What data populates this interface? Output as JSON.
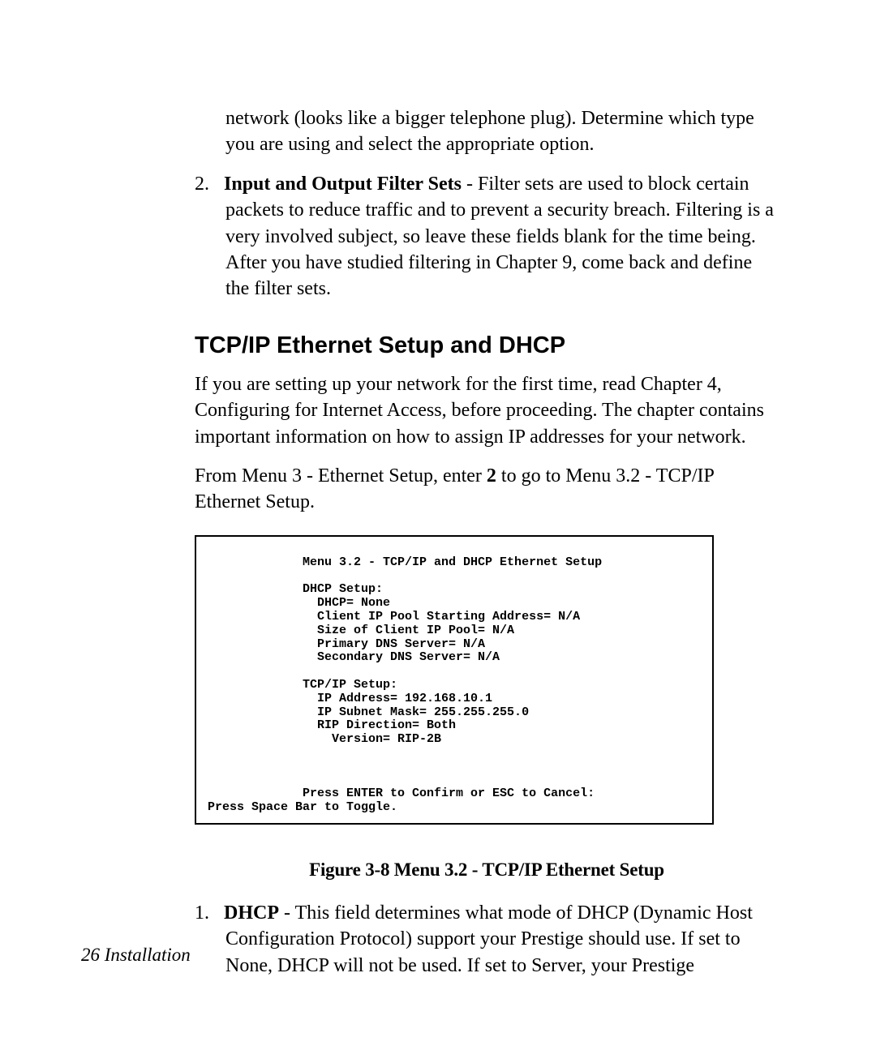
{
  "continuedPara": "network (looks like a bigger telephone plug). Determine which type you are using and select the appropriate option.",
  "listItem2": {
    "marker": "2.",
    "title": "Input and Output Filter Sets",
    "sep": " - ",
    "body": "Filter sets are used to block certain packets to reduce traffic and to prevent a security breach. Filtering is a very involved subject, so leave these fields blank for the time being. After you have studied filtering in Chapter 9, come back and define the filter sets."
  },
  "heading": "TCP/IP Ethernet Setup and DHCP",
  "bodyPara1": "If you are setting up your network for the first time, read Chapter 4, Configuring for Internet Access, before proceeding. The chapter contains important information on how to assign IP addresses for your network.",
  "bodyPara2_a": "From Menu 3 - Ethernet Setup, enter ",
  "bodyPara2_bold": "2",
  "bodyPara2_b": " to go to Menu 3.2 - TCP/IP Ethernet Setup.",
  "terminal": {
    "title": "             Menu 3.2 - TCP/IP and DHCP Ethernet Setup",
    "dhcp_h": "             DHCP Setup:",
    "dhcp_1": "               DHCP= None",
    "dhcp_2": "               Client IP Pool Starting Address= N/A",
    "dhcp_3": "               Size of Client IP Pool= N/A",
    "dhcp_4": "               Primary DNS Server= N/A",
    "dhcp_5": "               Secondary DNS Server= N/A",
    "tcp_h": "             TCP/IP Setup:",
    "tcp_1": "               IP Address= 192.168.10.1",
    "tcp_2": "               IP Subnet Mask= 255.255.255.0",
    "tcp_3": "               RIP Direction= Both",
    "tcp_4": "                 Version= RIP-2B",
    "confirm": "             Press ENTER to Confirm or ESC to Cancel:",
    "toggle": "Press Space Bar to Toggle."
  },
  "figureCaption": "Figure 3-8 Menu 3.2 - TCP/IP Ethernet Setup",
  "listItemA": {
    "marker": "1.",
    "title": "DHCP",
    "sep": " - ",
    "body": "This field determines what mode of DHCP (Dynamic Host Configuration Protocol) support your Prestige should use. If set to None, DHCP will not be used. If set to Server, your Prestige"
  },
  "footer": {
    "pageNum": "26",
    "section": "  Installation"
  }
}
